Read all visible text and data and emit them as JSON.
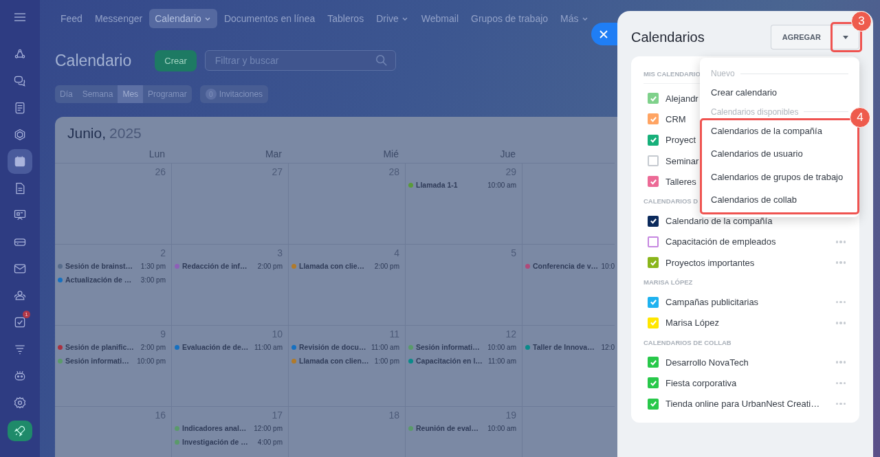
{
  "sidebar": {
    "items": [
      {
        "selected": false
      },
      {
        "selected": false
      },
      {
        "selected": false
      },
      {
        "selected": false
      },
      {
        "selected": true
      },
      {
        "selected": false
      },
      {
        "selected": false
      },
      {
        "selected": false
      },
      {
        "selected": false
      },
      {
        "selected": false
      },
      {
        "selected": false,
        "badge": "1"
      },
      {
        "selected": false
      },
      {
        "selected": false
      },
      {
        "selected": false
      }
    ]
  },
  "nav": [
    {
      "label": "Feed",
      "selected": false,
      "dropdown": false
    },
    {
      "label": "Messenger",
      "selected": false,
      "dropdown": false
    },
    {
      "label": "Calendario",
      "selected": true,
      "dropdown": true
    },
    {
      "label": "Documentos en línea",
      "selected": false,
      "dropdown": false
    },
    {
      "label": "Tableros",
      "selected": false,
      "dropdown": false
    },
    {
      "label": "Drive",
      "selected": false,
      "dropdown": true
    },
    {
      "label": "Webmail",
      "selected": false,
      "dropdown": false
    },
    {
      "label": "Grupos de trabajo",
      "selected": false,
      "dropdown": false
    },
    {
      "label": "Más",
      "selected": false,
      "dropdown": true
    }
  ],
  "toolbar": {
    "title": "Calendario",
    "create_button": "Crear",
    "search": {
      "placeholder": "Filtrar y buscar"
    },
    "views": [
      {
        "label": "Día",
        "selected": false
      },
      {
        "label": "Semana",
        "selected": false
      },
      {
        "label": "Mes",
        "selected": true
      },
      {
        "label": "Programar",
        "selected": false
      }
    ],
    "invitations": {
      "count": "0",
      "label": "Invitaciones"
    }
  },
  "calendar": {
    "month": "Junio,",
    "year": "2025",
    "days": [
      "Lun",
      "Mar",
      "Mié",
      "Jue"
    ],
    "weeks": [
      {
        "cells": [
          {
            "date": "26"
          },
          {
            "date": "27"
          },
          {
            "date": "28"
          },
          {
            "date": "29",
            "events": [
              {
                "title": "Llamada 1-1",
                "time": "10:00 am",
                "color": "#5a9a3a"
              }
            ]
          },
          {}
        ]
      },
      {
        "cells": [
          {
            "date": "2",
            "events": [
              {
                "title": "Sesión de brainst…",
                "time": "1:30 pm",
                "color": "#566b8a"
              },
              {
                "title": "Actualización de …",
                "time": "3:00 pm",
                "color": "#1670c0"
              }
            ]
          },
          {
            "date": "3",
            "events": [
              {
                "title": "Redacción de inf…",
                "time": "2:00 pm",
                "color": "#8e5fb8"
              }
            ]
          },
          {
            "date": "4",
            "events": [
              {
                "title": "Llamada con clie…",
                "time": "2:00 pm",
                "color": "#b07a2a"
              }
            ]
          },
          {
            "date": "5"
          },
          {
            "events": [
              {
                "title": "Conferencia de v…",
                "time": "10:0",
                "color": "#b04a7a"
              }
            ]
          }
        ]
      },
      {
        "cells": [
          {
            "date": "9",
            "events": [
              {
                "title": "Sesión de planific…",
                "time": "2:00 pm",
                "color": "#a83040"
              },
              {
                "title": "Sesión informati…",
                "time": "10:00 pm",
                "color": "#5a9a6a"
              }
            ]
          },
          {
            "date": "10",
            "events": [
              {
                "title": "Evaluación de de…",
                "time": "11:00 am",
                "color": "#1670c0"
              }
            ]
          },
          {
            "date": "11",
            "events": [
              {
                "title": "Revisión de docu…",
                "time": "11:00 am",
                "color": "#1670c0"
              },
              {
                "title": "Llamada con clien…",
                "time": "1:00 pm",
                "color": "#b07a2a"
              }
            ]
          },
          {
            "date": "12",
            "events": [
              {
                "title": "Sesión informati…",
                "time": "10:00 am",
                "color": "#5a9a6a"
              },
              {
                "title": "Capacitación en l…",
                "time": "11:00 am",
                "color": "#0a8a8a"
              }
            ]
          },
          {
            "events": [
              {
                "title": "Taller de Innova…",
                "time": "12:0",
                "color": "#0a8a8a"
              }
            ]
          }
        ]
      },
      {
        "cells": [
          {
            "date": "16"
          },
          {
            "date": "17",
            "events": [
              {
                "title": "Indicadores anal…",
                "time": "12:00 pm",
                "color": "#5a9a6a"
              },
              {
                "title": "Investigación de …",
                "time": "4:00 pm",
                "color": "#5a9a6a"
              }
            ]
          },
          {
            "date": "18"
          },
          {
            "date": "19",
            "events": [
              {
                "title": "Reunión de eval…",
                "time": "10:00 am",
                "color": "#5a9a6a"
              }
            ]
          },
          {}
        ]
      }
    ]
  },
  "panel": {
    "title": "Calendarios",
    "add_button": "AGREGAR",
    "menu_button_annotation": "3",
    "sections": [
      {
        "heading": "MIS CALENDARIO",
        "items": [
          {
            "name": "Alejandr",
            "checked": true,
            "color": "#7fd18b",
            "actions": false
          },
          {
            "name": "CRM",
            "checked": true,
            "color": "#ffa463",
            "actions": false
          },
          {
            "name": "Proyect",
            "checked": true,
            "color": "#17b07a",
            "actions": false
          },
          {
            "name": "Seminar",
            "checked": false,
            "color": "#c5cad0",
            "actions": false
          },
          {
            "name": "Talleres",
            "checked": true,
            "color": "#ec6a96",
            "actions": false
          }
        ]
      },
      {
        "heading": "CALENDARIOS D",
        "items": [
          {
            "name": "Calendario de la compañía",
            "checked": true,
            "color": "#0b2a5c",
            "actions": false
          },
          {
            "name": "Capacitación de empleados",
            "checked": false,
            "color": "#c586e0",
            "actions": true
          },
          {
            "name": "Proyectos importantes",
            "checked": true,
            "color": "#8ab51b",
            "actions": true
          }
        ]
      },
      {
        "heading": "MARISA LÓPEZ",
        "items": [
          {
            "name": "Campañas publicitarias",
            "checked": true,
            "color": "#1fb2f0",
            "actions": true
          },
          {
            "name": "Marisa López",
            "checked": true,
            "color": "#ffe600",
            "actions": true
          }
        ]
      },
      {
        "heading": "CALENDARIOS DE COLLAB",
        "items": [
          {
            "name": "Desarrollo NovaTech",
            "checked": true,
            "color": "#28c84a",
            "actions": true
          },
          {
            "name": "Fiesta corporativa",
            "checked": true,
            "color": "#28c84a",
            "actions": true
          },
          {
            "name": "Tienda online para UrbanNest Creati…",
            "checked": true,
            "color": "#28c84a",
            "actions": true
          }
        ]
      }
    ],
    "menu": {
      "groups": [
        {
          "heading": "Nuevo",
          "items": [
            "Crear calendario"
          ]
        },
        {
          "heading": "Calendarios disponibles",
          "annotation": "4",
          "items": [
            "Calendarios de la compañía",
            "Calendarios de usuario",
            "Calendarios de grupos de trabajo",
            "Calendarios de collab"
          ]
        }
      ]
    }
  }
}
